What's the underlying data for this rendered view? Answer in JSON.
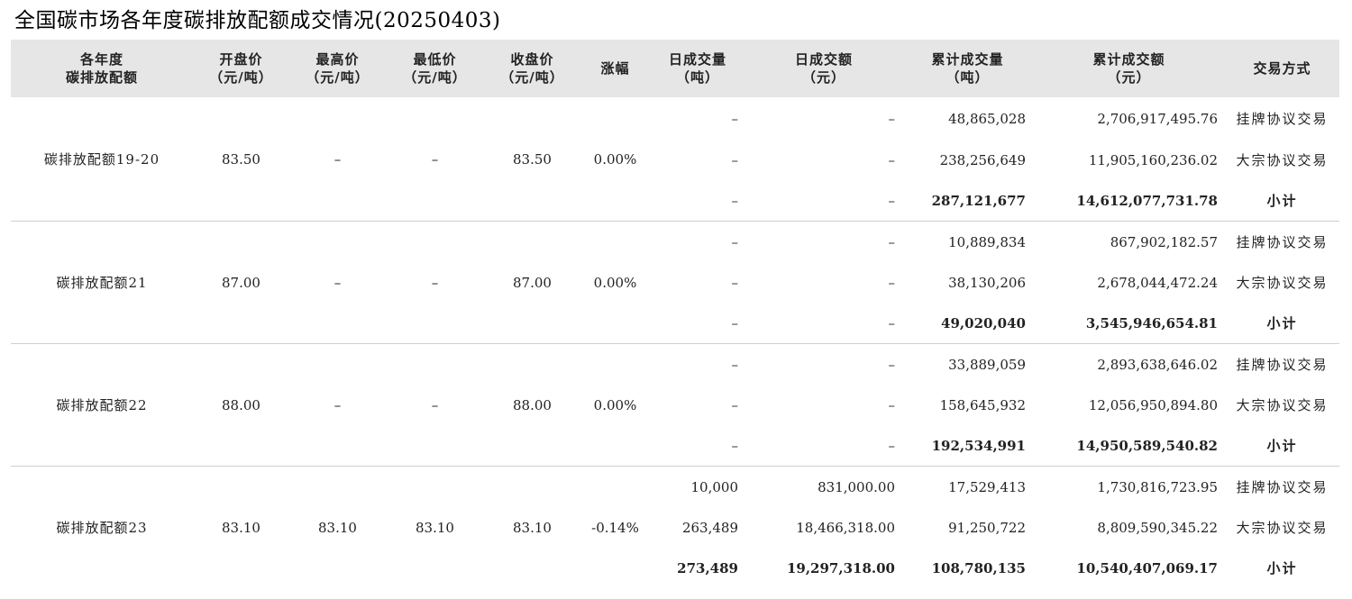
{
  "title": "全国碳市场各年度碳排放配额成交情况(20250403)",
  "headers": [
    {
      "line1": "各年度",
      "line2": "碳排放配额"
    },
    {
      "line1": "开盘价",
      "line2": "（元/吨）"
    },
    {
      "line1": "最高价",
      "line2": "（元/吨）"
    },
    {
      "line1": "最低价",
      "line2": "（元/吨）"
    },
    {
      "line1": "收盘价",
      "line2": "（元/吨）"
    },
    {
      "line1": "涨幅",
      "line2": ""
    },
    {
      "line1": "日成交量",
      "line2": "（吨）"
    },
    {
      "line1": "日成交额",
      "line2": "（元）"
    },
    {
      "line1": "累计成交量",
      "line2": "（吨）"
    },
    {
      "line1": "累计成交额",
      "line2": "（元）"
    },
    {
      "line1": "交易方式",
      "line2": ""
    }
  ],
  "groups": [
    {
      "name": "碳排放配额19-20",
      "open": "83.50",
      "high": "–",
      "low": "–",
      "close": "83.50",
      "change": "0.00%",
      "rows": [
        {
          "daily_vol": "–",
          "daily_amt": "–",
          "cum_vol": "48,865,028",
          "cum_amt": "2,706,917,495.76",
          "method": "挂牌协议交易"
        },
        {
          "daily_vol": "–",
          "daily_amt": "–",
          "cum_vol": "238,256,649",
          "cum_amt": "11,905,160,236.02",
          "method": "大宗协议交易"
        },
        {
          "daily_vol": "–",
          "daily_amt": "–",
          "cum_vol": "287,121,677",
          "cum_amt": "14,612,077,731.78",
          "method": "小计"
        }
      ]
    },
    {
      "name": "碳排放配额21",
      "open": "87.00",
      "high": "–",
      "low": "–",
      "close": "87.00",
      "change": "0.00%",
      "rows": [
        {
          "daily_vol": "–",
          "daily_amt": "–",
          "cum_vol": "10,889,834",
          "cum_amt": "867,902,182.57",
          "method": "挂牌协议交易"
        },
        {
          "daily_vol": "–",
          "daily_amt": "–",
          "cum_vol": "38,130,206",
          "cum_amt": "2,678,044,472.24",
          "method": "大宗协议交易"
        },
        {
          "daily_vol": "–",
          "daily_amt": "–",
          "cum_vol": "49,020,040",
          "cum_amt": "3,545,946,654.81",
          "method": "小计"
        }
      ]
    },
    {
      "name": "碳排放配额22",
      "open": "88.00",
      "high": "–",
      "low": "–",
      "close": "88.00",
      "change": "0.00%",
      "rows": [
        {
          "daily_vol": "–",
          "daily_amt": "–",
          "cum_vol": "33,889,059",
          "cum_amt": "2,893,638,646.02",
          "method": "挂牌协议交易"
        },
        {
          "daily_vol": "–",
          "daily_amt": "–",
          "cum_vol": "158,645,932",
          "cum_amt": "12,056,950,894.80",
          "method": "大宗协议交易"
        },
        {
          "daily_vol": "–",
          "daily_amt": "–",
          "cum_vol": "192,534,991",
          "cum_amt": "14,950,589,540.82",
          "method": "小计"
        }
      ]
    },
    {
      "name": "碳排放配额23",
      "open": "83.10",
      "high": "83.10",
      "low": "83.10",
      "close": "83.10",
      "change": "-0.14%",
      "rows": [
        {
          "daily_vol": "10,000",
          "daily_amt": "831,000.00",
          "cum_vol": "17,529,413",
          "cum_amt": "1,730,816,723.95",
          "method": "挂牌协议交易"
        },
        {
          "daily_vol": "263,489",
          "daily_amt": "18,466,318.00",
          "cum_vol": "91,250,722",
          "cum_amt": "8,809,590,345.22",
          "method": "大宗协议交易"
        },
        {
          "daily_vol": "273,489",
          "daily_amt": "19,297,318.00",
          "cum_vol": "108,780,135",
          "cum_amt": "10,540,407,069.17",
          "method": "小计"
        }
      ]
    }
  ]
}
